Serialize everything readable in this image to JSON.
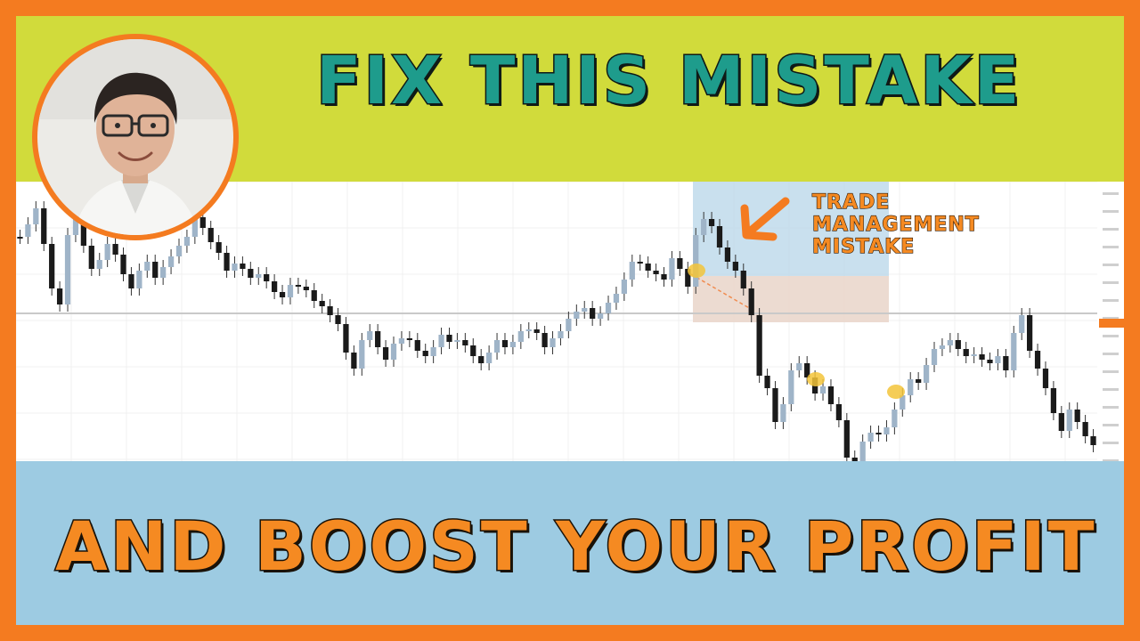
{
  "thumbnail": {
    "headline_top": "FIX THIS MISTAKE",
    "headline_bottom": "AND BOOST YOUR PROFIT",
    "annotation": [
      "TRADE",
      "MANAGEMENT",
      "MISTAKE"
    ],
    "icons": {
      "avatar": "presenter-photo",
      "arrow": "arrow-pointing-down-left-icon"
    },
    "colors": {
      "frame": "#f47b20",
      "top_band": "#d1db3b",
      "bottom_band": "#9dcbe2",
      "headline_top": "#1e9c8c",
      "headline_bottom": "#f58a22",
      "annotation": "#f58a22"
    }
  },
  "chart_data": {
    "type": "candlestick",
    "grid": true,
    "series_close": [
      62,
      48,
      30,
      70,
      120,
      138,
      60,
      42,
      72,
      98,
      88,
      70,
      82,
      104,
      120,
      100,
      90,
      108,
      96,
      84,
      72,
      62,
      40,
      52,
      68,
      80,
      100,
      92,
      98,
      108,
      104,
      112,
      124,
      130,
      116,
      118,
      122,
      134,
      140,
      150,
      160,
      192,
      210,
      178,
      168,
      186,
      200,
      182,
      176,
      178,
      190,
      196,
      186,
      172,
      180,
      178,
      184,
      196,
      204,
      192,
      178,
      186,
      180,
      168,
      166,
      170,
      186,
      176,
      168,
      154,
      146,
      142,
      154,
      148,
      136,
      126,
      110,
      90,
      92,
      100,
      104,
      110,
      86,
      98,
      118,
      60,
      42,
      50,
      74,
      90,
      100,
      120,
      150,
      218,
      232,
      270,
      250,
      212,
      204,
      220,
      238,
      230,
      250,
      268,
      310,
      318,
      292,
      282,
      284,
      276,
      256,
      240,
      222,
      226,
      206,
      188,
      184,
      178,
      188,
      196,
      194,
      200,
      204,
      196,
      212,
      170,
      150,
      190,
      210,
      232,
      260,
      280,
      256,
      270,
      286,
      296
    ]
  }
}
